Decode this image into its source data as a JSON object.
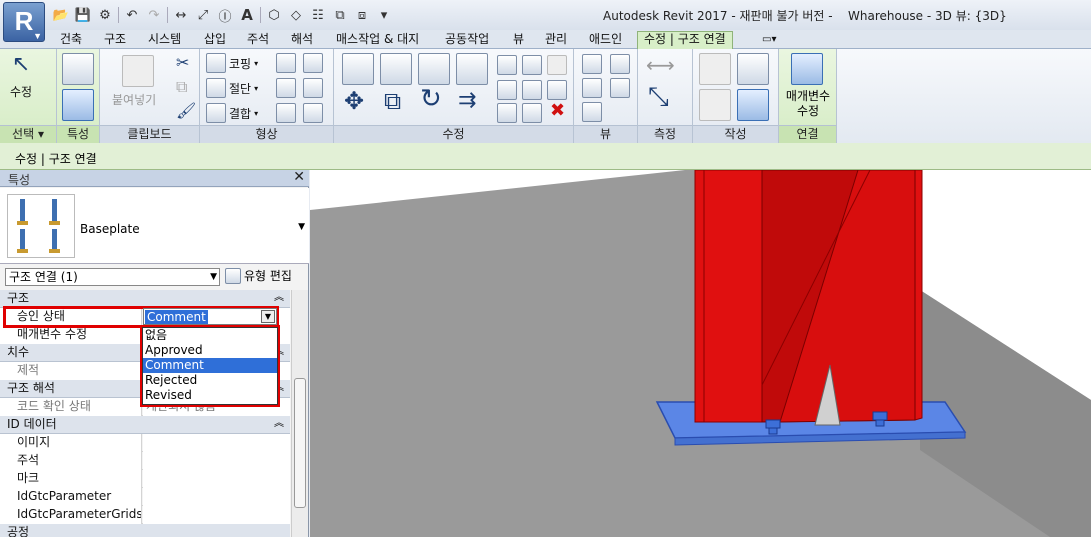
{
  "app": {
    "button_letter": "R",
    "title": "Autodesk Revit 2017 - 재판매 불가 버전 -",
    "view_title": "Wharehouse - 3D 뷰: {3D}"
  },
  "tabs": [
    "건축",
    "구조",
    "시스템",
    "삽입",
    "주석",
    "해석",
    "매스작업 & 대지",
    "공동작업",
    "뷰",
    "관리",
    "애드인",
    "수정 | 구조 연결"
  ],
  "ribbon": {
    "panels": {
      "select": "선택",
      "properties": "특성",
      "clipboard": "클립보드",
      "geometry": "형상",
      "modify": "수정",
      "view": "뷰",
      "measure": "측정",
      "create": "작성",
      "connection": "연결"
    },
    "modify_button": "수정",
    "paste_button": "붙여넣기",
    "cope": "코핑",
    "cut": "절단",
    "join": "결합",
    "edit_params": "매개변수\n수정"
  },
  "context_bar": {
    "label": "수정 | 구조 연결"
  },
  "properties": {
    "title": "특성",
    "type_name": "Baseplate",
    "instance_selector": "구조 연결 (1)",
    "edit_type": "유형 편집",
    "rows": [
      {
        "kind": "group",
        "label": "구조"
      },
      {
        "kind": "param",
        "label": "승인 상태",
        "value": ""
      },
      {
        "kind": "param",
        "label": "매개변수 수정",
        "value": ""
      },
      {
        "kind": "group",
        "label": "치수"
      },
      {
        "kind": "param",
        "label": "제적",
        "value": "",
        "dim": true
      },
      {
        "kind": "group",
        "label": "구조 해석"
      },
      {
        "kind": "param",
        "label": "코드 확인 상태",
        "value": "계산되지 않음",
        "dim": true
      },
      {
        "kind": "group",
        "label": "ID 데이터"
      },
      {
        "kind": "param",
        "label": "이미지",
        "value": ""
      },
      {
        "kind": "param",
        "label": "주석",
        "value": ""
      },
      {
        "kind": "param",
        "label": "마크",
        "value": ""
      },
      {
        "kind": "param",
        "label": "IdGtcParameter",
        "value": ""
      },
      {
        "kind": "param",
        "label": "IdGtcParameterGrids",
        "value": ""
      },
      {
        "kind": "group",
        "label": "공정"
      }
    ],
    "approval_combo": {
      "value": "Comment",
      "options": [
        "없음",
        "Approved",
        "Comment",
        "Rejected",
        "Revised"
      ],
      "selected": "Comment"
    }
  },
  "colors": {
    "accent_red": "#e00000",
    "selection_blue": "#2f6fd8",
    "column_red": "#e01010",
    "plate_blue": "#5b86e6",
    "ground_grey": "#9a9a9a"
  }
}
